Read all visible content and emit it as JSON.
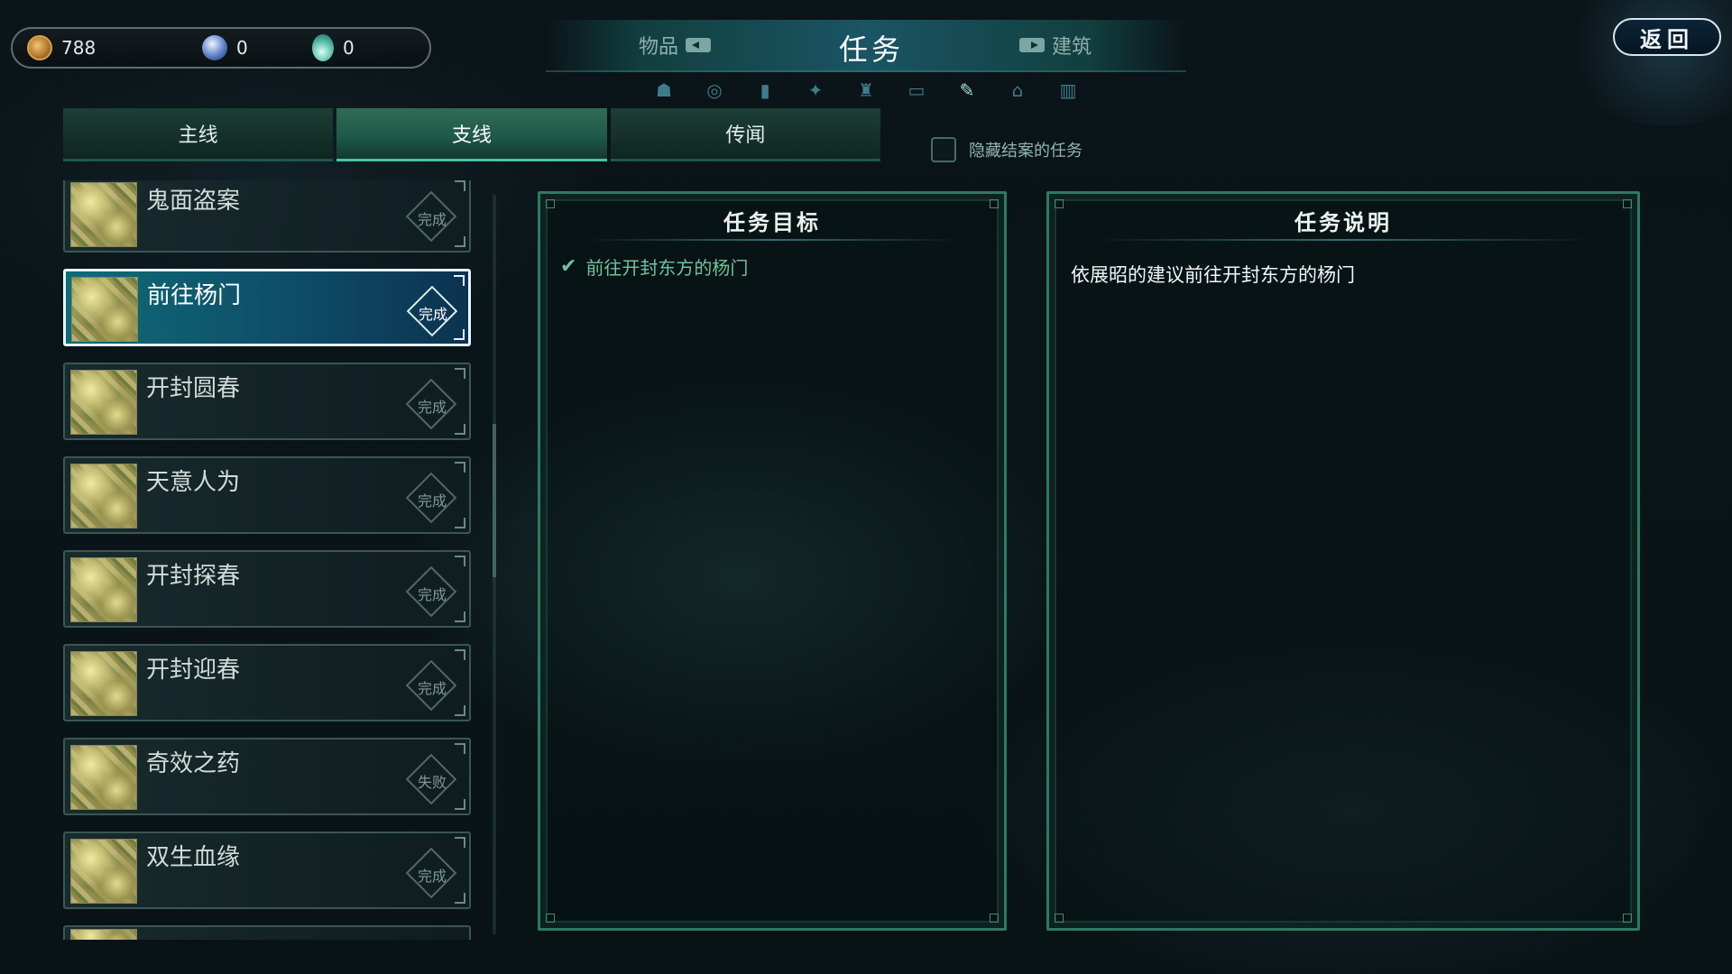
{
  "currencies": [
    {
      "icon": "copper-coin-icon",
      "value": "788"
    },
    {
      "icon": "spirit-orb-icon",
      "value": "0"
    },
    {
      "icon": "water-drop-icon",
      "value": "0"
    }
  ],
  "categories": {
    "left": "物品",
    "active": "任务",
    "right": "建筑"
  },
  "return_label": "返回",
  "category_icons": [
    "ghost-icon",
    "swirl-icon",
    "book-icon",
    "martial-figure-icon",
    "robe-icon",
    "chest-icon",
    "scroll-icon",
    "pavilion-icon",
    "bookshelf-icon"
  ],
  "active_category_icon_index": 6,
  "quest_tabs": [
    "主线",
    "支线",
    "传闻"
  ],
  "active_quest_tab": 1,
  "hide_finished_label": "隐藏结案的任务",
  "quests": [
    {
      "title": "鬼面盗案",
      "status": "完成"
    },
    {
      "title": "前往杨门",
      "status": "完成",
      "selected": true
    },
    {
      "title": "开封圆春",
      "status": "完成"
    },
    {
      "title": "天意人为",
      "status": "完成"
    },
    {
      "title": "开封探春",
      "status": "完成"
    },
    {
      "title": "开封迎春",
      "status": "完成"
    },
    {
      "title": "奇效之药",
      "status": "失败"
    },
    {
      "title": "双生血缘",
      "status": "完成"
    }
  ],
  "objectives_panel": {
    "title": "任务目标",
    "items": [
      "前往开封东方的杨门"
    ]
  },
  "description_panel": {
    "title": "任务说明",
    "text": "依展昭的建议前往开封东方的杨门"
  },
  "colors": {
    "accent_teal": "#2d7a60",
    "objective_green": "#6fc39a",
    "selected_bg": "#0f6c78"
  }
}
